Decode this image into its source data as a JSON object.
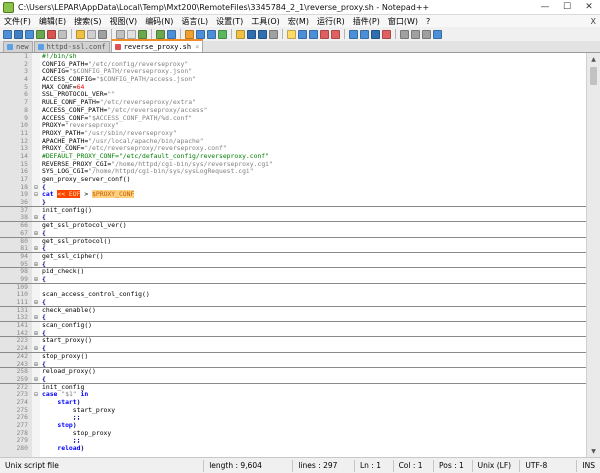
{
  "window": {
    "title": "C:\\Users\\LEPAR\\AppData\\Local\\Temp\\Mxt200\\RemoteFiles\\3345784_2_1\\reverse_proxy.sh - Notepad++",
    "minimize": "—",
    "maximize": "☐",
    "close": "✕"
  },
  "menu": [
    "文件(F)",
    "编辑(E)",
    "搜索(S)",
    "视图(V)",
    "编码(N)",
    "语言(L)",
    "设置(T)",
    "工具(O)",
    "宏(M)",
    "运行(R)",
    "插件(P)",
    "窗口(W)",
    "?"
  ],
  "menu_close": "X",
  "toolbar_colors": [
    "#4a8fd8",
    "#3f7fc4",
    "#4a8fd8",
    "#6aa84f",
    "#d9534f",
    "#c0c0c0",
    "#f0c040",
    "#d0d0d0",
    "#a0a0a0",
    "#c0c0c0",
    "#e0e0e0",
    "#6aa84f",
    "#6aa84f",
    "#4a8fd8",
    "#f0a030",
    "#4a8fd8",
    "#4a8fd8",
    "#5cb85c",
    "#f0c040",
    "#2f6fb0",
    "#2f6fb0",
    "#a0a0a0",
    "#ffd966",
    "#4a8fd8",
    "#4a8fd8",
    "#e06060",
    "#e06060",
    "#4a8fd8",
    "#4a8fd8",
    "#2f6fb0",
    "#e06060",
    "#a0a0a0",
    "#a0a0a0",
    "#a0a0a0",
    "#4a8fd8"
  ],
  "tabs": [
    {
      "label": "new",
      "icon": "blue",
      "active": false
    },
    {
      "label": "httpd-ssl.conf",
      "icon": "blue",
      "active": false
    },
    {
      "label": "reverse_proxy.sh",
      "icon": "red",
      "active": true
    }
  ],
  "code_lines": [
    {
      "n": "1",
      "fold": "",
      "parts": [
        [
          "c",
          "#!/bin/sh"
        ]
      ]
    },
    {
      "n": "2",
      "fold": "",
      "parts": [
        [
          "v",
          "CONFIG_PATH="
        ],
        [
          "s",
          "\"/etc/config/reverseproxy\""
        ]
      ]
    },
    {
      "n": "3",
      "fold": "",
      "parts": [
        [
          "v",
          "CONFIG="
        ],
        [
          "s",
          "\"$CONFIG_PATH/reverseproxy.json\""
        ]
      ]
    },
    {
      "n": "4",
      "fold": "",
      "parts": [
        [
          "v",
          "ACCESS_CONFIG="
        ],
        [
          "s",
          "\"$CONFIG_PATH/access.json\""
        ]
      ]
    },
    {
      "n": "5",
      "fold": "",
      "parts": [
        [
          "v",
          "MAX_CONF="
        ],
        [
          "n",
          "64"
        ]
      ]
    },
    {
      "n": "6",
      "fold": "",
      "parts": [
        [
          "v",
          "SSL_PROTOCOL_VER="
        ],
        [
          "s",
          "\"\""
        ]
      ]
    },
    {
      "n": "7",
      "fold": "",
      "parts": [
        [
          "v",
          "RULE_CONF_PATH="
        ],
        [
          "s",
          "\"/etc/reverseproxy/extra\""
        ]
      ]
    },
    {
      "n": "8",
      "fold": "",
      "parts": [
        [
          "v",
          "ACCESS_CONF_PATH="
        ],
        [
          "s",
          "\"/etc/reverseproxy/access\""
        ]
      ]
    },
    {
      "n": "9",
      "fold": "",
      "parts": [
        [
          "v",
          "ACCESS_CONF="
        ],
        [
          "s",
          "\"$ACCESS_CONF_PATH/%d.conf\""
        ]
      ]
    },
    {
      "n": "10",
      "fold": "",
      "parts": [
        [
          "v",
          "PROXY="
        ],
        [
          "s",
          "\"reverseproxy\""
        ]
      ]
    },
    {
      "n": "11",
      "fold": "",
      "parts": [
        [
          "v",
          "PROXY_PATH="
        ],
        [
          "s",
          "\"/usr/sbin/reverseproxy\""
        ]
      ]
    },
    {
      "n": "12",
      "fold": "",
      "parts": [
        [
          "v",
          "APACHE_PATH="
        ],
        [
          "s",
          "\"/usr/local/apache/bin/apache\""
        ]
      ]
    },
    {
      "n": "13",
      "fold": "",
      "parts": [
        [
          "v",
          "PROXY_CONF="
        ],
        [
          "s",
          "\"/etc/reverseproxy/reverseproxy.conf\""
        ]
      ]
    },
    {
      "n": "14",
      "fold": "",
      "parts": [
        [
          "c",
          "#DEFAULT_PROXY_CONF=\"/etc/default_config/reverseproxy.conf\""
        ]
      ]
    },
    {
      "n": "15",
      "fold": "",
      "parts": [
        [
          "v",
          "REVERSE_PROXY_CGI="
        ],
        [
          "s",
          "\"/home/httpd/cgi-bin/sys/reverseproxy.cgi\""
        ]
      ]
    },
    {
      "n": "16",
      "fold": "",
      "parts": [
        [
          "v",
          "SYS_LOG_CGI="
        ],
        [
          "s",
          "\"/home/httpd/cgi-bin/sys/sysLogRequest.cgi\""
        ]
      ]
    },
    {
      "n": "17",
      "fold": "",
      "parts": [
        [
          "v",
          "gen_proxy_server_conf()"
        ]
      ]
    },
    {
      "n": "18",
      "fold": "⊟",
      "parts": [
        [
          "op",
          "{"
        ]
      ]
    },
    {
      "n": "19",
      "fold": "⊟",
      "parts": [
        [
          "k",
          "cat "
        ],
        [
          "here",
          "<< EOF"
        ],
        [
          "v",
          " > "
        ],
        [
          "heredoc",
          "$PROXY_CONF"
        ]
      ]
    },
    {
      "n": "36",
      "fold": "",
      "parts": [
        [
          "op",
          "}"
        ]
      ],
      "sep": true
    },
    {
      "n": "37",
      "fold": "",
      "parts": [
        [
          "v",
          "init_config()"
        ]
      ]
    },
    {
      "n": "38",
      "fold": "⊞",
      "parts": [
        [
          "op",
          "{"
        ]
      ],
      "sep": true
    },
    {
      "n": "66",
      "fold": "",
      "parts": [
        [
          "v",
          "get_ssl_protocol_ver()"
        ]
      ]
    },
    {
      "n": "67",
      "fold": "⊞",
      "parts": [
        [
          "op",
          "{"
        ]
      ],
      "sep": true
    },
    {
      "n": "80",
      "fold": "",
      "parts": [
        [
          "v",
          "get_ssl_protocol()"
        ]
      ]
    },
    {
      "n": "81",
      "fold": "⊞",
      "parts": [
        [
          "op",
          "{"
        ]
      ],
      "sep": true
    },
    {
      "n": "94",
      "fold": "",
      "parts": [
        [
          "v",
          "get_ssl_cipher()"
        ]
      ]
    },
    {
      "n": "95",
      "fold": "⊞",
      "parts": [
        [
          "op",
          "{"
        ]
      ],
      "sep": true
    },
    {
      "n": "98",
      "fold": "",
      "parts": [
        [
          "v",
          "pid_check()"
        ]
      ]
    },
    {
      "n": "99",
      "fold": "⊞",
      "parts": [
        [
          "op",
          "{"
        ]
      ],
      "sep": true
    },
    {
      "n": "109",
      "fold": "",
      "parts": [
        [
          "v",
          ""
        ]
      ]
    },
    {
      "n": "110",
      "fold": "",
      "parts": [
        [
          "v",
          "scan_access_control_config()"
        ]
      ]
    },
    {
      "n": "111",
      "fold": "⊞",
      "parts": [
        [
          "op",
          "{"
        ]
      ],
      "sep": true
    },
    {
      "n": "131",
      "fold": "",
      "parts": [
        [
          "v",
          "check_enable()"
        ]
      ]
    },
    {
      "n": "132",
      "fold": "⊞",
      "parts": [
        [
          "op",
          "{"
        ]
      ],
      "sep": true
    },
    {
      "n": "141",
      "fold": "",
      "parts": [
        [
          "v",
          "scan_config()"
        ]
      ]
    },
    {
      "n": "142",
      "fold": "⊞",
      "parts": [
        [
          "op",
          "{"
        ]
      ],
      "sep": true
    },
    {
      "n": "223",
      "fold": "",
      "parts": [
        [
          "v",
          "start_proxy()"
        ]
      ]
    },
    {
      "n": "224",
      "fold": "⊞",
      "parts": [
        [
          "op",
          "{"
        ]
      ],
      "sep": true
    },
    {
      "n": "242",
      "fold": "",
      "parts": [
        [
          "v",
          "stop_proxy()"
        ]
      ]
    },
    {
      "n": "243",
      "fold": "⊞",
      "parts": [
        [
          "op",
          "{"
        ]
      ],
      "sep": true
    },
    {
      "n": "258",
      "fold": "",
      "parts": [
        [
          "v",
          "reload_proxy()"
        ]
      ]
    },
    {
      "n": "259",
      "fold": "⊞",
      "parts": [
        [
          "op",
          "{"
        ]
      ],
      "sep": true
    },
    {
      "n": "272",
      "fold": "",
      "parts": [
        [
          "v",
          "init_config"
        ]
      ]
    },
    {
      "n": "273",
      "fold": "⊟",
      "parts": [
        [
          "k",
          "case "
        ],
        [
          "s",
          "\"$1\""
        ],
        [
          "k",
          " in"
        ]
      ]
    },
    {
      "n": "274",
      "fold": "",
      "parts": [
        [
          "v",
          "    "
        ],
        [
          "k",
          "start"
        ],
        [
          "op",
          ")"
        ]
      ]
    },
    {
      "n": "275",
      "fold": "",
      "parts": [
        [
          "v",
          "        start_proxy"
        ]
      ]
    },
    {
      "n": "276",
      "fold": "",
      "parts": [
        [
          "v",
          "        "
        ],
        [
          "op",
          ";;"
        ]
      ]
    },
    {
      "n": "277",
      "fold": "",
      "parts": [
        [
          "v",
          "    "
        ],
        [
          "k",
          "stop"
        ],
        [
          "op",
          ")"
        ]
      ]
    },
    {
      "n": "278",
      "fold": "",
      "parts": [
        [
          "v",
          "        stop_proxy"
        ]
      ]
    },
    {
      "n": "279",
      "fold": "",
      "parts": [
        [
          "v",
          "        "
        ],
        [
          "op",
          ";;"
        ]
      ]
    },
    {
      "n": "280",
      "fold": "",
      "parts": [
        [
          "v",
          "    "
        ],
        [
          "k",
          "reload"
        ],
        [
          "op",
          ")"
        ]
      ]
    }
  ],
  "status": {
    "file_type": "Unix script file",
    "length": "length : 9,604",
    "lines": "lines : 297",
    "ln": "Ln : 1",
    "col": "Col : 1",
    "pos": "Pos : 1",
    "eol": "Unix (LF)",
    "encoding": "UTF-8",
    "mode": "INS"
  }
}
